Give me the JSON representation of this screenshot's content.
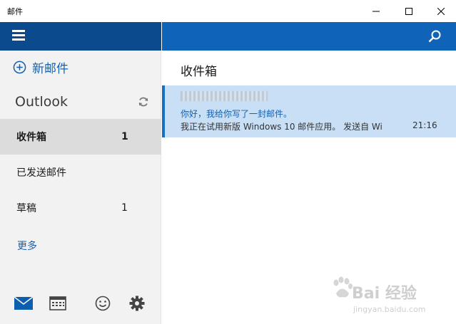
{
  "window": {
    "title": "邮件"
  },
  "nav": {
    "new_mail_label": "新邮件",
    "account_name": "Outlook",
    "folders": [
      {
        "name": "收件箱",
        "count": "1",
        "selected": true
      },
      {
        "name": "已发送邮件",
        "count": ""
      },
      {
        "name": "草稿",
        "count": "1"
      }
    ],
    "more_label": "更多",
    "bottom_icons": [
      "mail-icon",
      "calendar-icon",
      "smiley-icon",
      "gear-icon"
    ]
  },
  "main": {
    "folder_title": "收件箱",
    "messages": [
      {
        "sender": "",
        "subject": "你好，我给你写了一封邮件。",
        "preview": "我正在试用新版 Windows 10 邮件应用。 发送自 Wi",
        "time": "21:16"
      }
    ]
  },
  "watermark": {
    "brand": "Bai 经验",
    "url": "jingyan.baidu.com"
  },
  "colors": {
    "nav_header": "#0b4a8c",
    "main_header": "#0f63b8",
    "accent_text": "#1561b0",
    "selected_message": "#c9dff5"
  }
}
